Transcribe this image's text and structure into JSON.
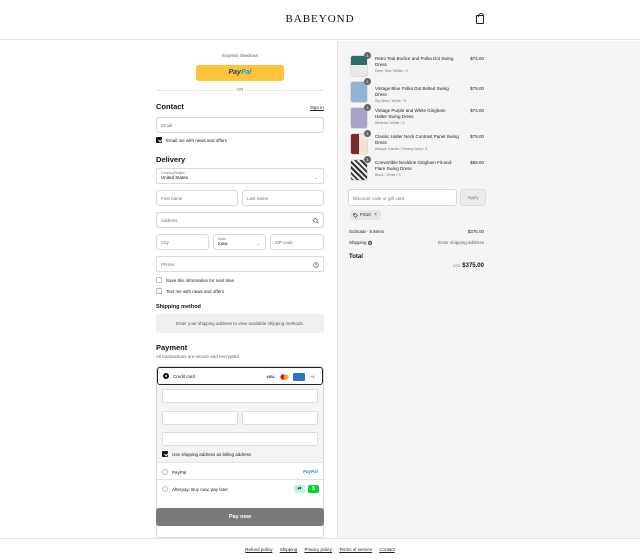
{
  "brand": "BABEYOND",
  "express": {
    "label": "Express checkout",
    "paypal_a": "Pay",
    "paypal_b": "Pal",
    "or": "OR"
  },
  "contact": {
    "title": "Contact",
    "signin": "Sign in",
    "email_placeholder": "Email",
    "news_label": "Email me with news and offers"
  },
  "delivery": {
    "title": "Delivery",
    "country_label": "Country/Region",
    "country_value": "United States",
    "first_name": "First name",
    "last_name": "Last name",
    "address": "Address",
    "city": "City",
    "state_label": "State",
    "state_value": "Iowa",
    "zip": "ZIP code",
    "phone": "Phone",
    "save_info": "Save this information for next time",
    "text_me": "Text me with news and offers"
  },
  "shipping": {
    "title": "Shipping method",
    "message": "Enter your shipping address to view available shipping methods."
  },
  "payment": {
    "title": "Payment",
    "subtitle": "All transactions are secure and encrypted.",
    "credit_card": "Credit card",
    "cards": [
      "VISA",
      "MC",
      "AMEX",
      "+4"
    ],
    "billing_same": "Use shipping address as billing address",
    "paypal": "PayPal",
    "paypal_logo": "PayPal",
    "afterpay": "Afterpay: Buy now, pay later",
    "pay_now": "Pay now"
  },
  "order": {
    "items": [
      {
        "name": "Retro Teal Bodice and Polka Dot Swing Dress",
        "variant": "Deep Teal / White / S",
        "price": "$74.00",
        "qty": "1"
      },
      {
        "name": "Vintage Blue Polka Dot Belted Swing Dress",
        "variant": "Sky Blue / White / S",
        "price": "$79.00",
        "qty": "1"
      },
      {
        "name": "Vintage Purple and White Gingham Halter Swing Dress",
        "variant": "Wisteria / White / S",
        "price": "$74.00",
        "qty": "1"
      },
      {
        "name": "Classic Halter Neck Contrast Panel Swing Dress",
        "variant": "Antique Garnet / Creamy Ivory / S",
        "price": "$79.00",
        "qty": "1"
      },
      {
        "name": "Convertible Neckline Gingham Fit-and-Flare Swing Dress",
        "variant": "Black / White / S",
        "price": "$69.00",
        "qty": "1"
      }
    ],
    "code_placeholder": "Discount code or gift card",
    "apply": "Apply",
    "discount_chip": "FS10",
    "subtotal_label": "Subtotal · 5 items",
    "subtotal_value": "$375.00",
    "shipping_label": "Shipping",
    "shipping_value": "Enter shipping address",
    "total_label": "Total",
    "currency": "USD",
    "total_value": "$375.00"
  },
  "footer": [
    "Refund policy",
    "Shipping",
    "Privacy policy",
    "Terms of service",
    "Contact"
  ],
  "colors": {
    "paypal_yellow": "#ffc439",
    "pay_button": "#7a7a7a",
    "amex": "#2e77bc",
    "afterpay": "#b2fce4",
    "cashapp": "#00d632"
  }
}
